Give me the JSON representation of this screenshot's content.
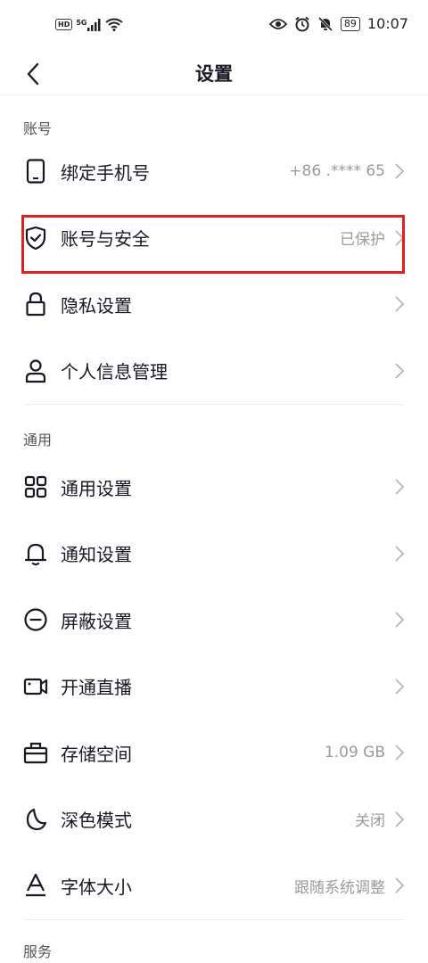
{
  "status_bar": {
    "hd_label": "HD",
    "network_label": "5G",
    "battery_level": "89",
    "time": "10:07"
  },
  "nav": {
    "title": "设置"
  },
  "sections": {
    "account": {
      "header": "账号",
      "bind_phone_label": "绑定手机号",
      "bind_phone_value": "+86  .****  65",
      "account_security_label": "账号与安全",
      "account_security_value": "已保护",
      "privacy_label": "隐私设置",
      "personal_info_label": "个人信息管理"
    },
    "general": {
      "header": "通用",
      "general_settings_label": "通用设置",
      "notification_label": "通知设置",
      "block_label": "屏蔽设置",
      "live_label": "开通直播",
      "storage_label": "存储空间",
      "storage_value": "1.09 GB",
      "dark_mode_label": "深色模式",
      "dark_mode_value": "关闭",
      "font_size_label": "字体大小",
      "font_size_value": "跟随系统调整"
    },
    "service": {
      "header": "服务"
    }
  },
  "colors": {
    "highlight_border": "#e02020",
    "text_primary": "#161823",
    "text_secondary": "#9a9a9a"
  },
  "icons": [
    "hd-icon",
    "signal-icon",
    "wifi-icon",
    "eye-icon",
    "alarm-icon",
    "mute-bell-icon",
    "battery-icon",
    "back-arrow-icon",
    "phone-icon",
    "shield-check-icon",
    "lock-icon",
    "person-icon",
    "grid-icon",
    "bell-icon",
    "block-icon",
    "video-camera-icon",
    "briefcase-icon",
    "moon-icon",
    "font-a-icon",
    "chevron-right-icon"
  ]
}
